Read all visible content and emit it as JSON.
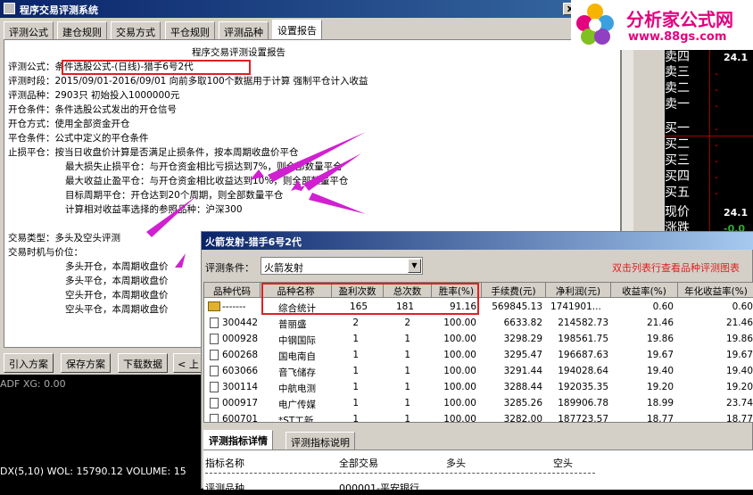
{
  "main_window": {
    "title": "程序交易评测系统",
    "close_label": "x",
    "tabs": [
      "评测公式",
      "建仓规则",
      "交易方式",
      "平仓规则",
      "评测品种",
      "设置报告"
    ],
    "report": {
      "heading": "程序交易评测设置报告",
      "lines": [
        "评测公式：条件选股公式-(日线)-猎手6号2代",
        "评测时段：2015/09/01-2016/09/01  向前多取100个数据用于计算  强制平仓计入收益",
        "评测品种：2903只  初始投入1000000元",
        "开仓条件：条件选股公式发出的开仓信号",
        "开仓方式：使用全部资金开仓",
        "平仓条件：公式中定义的平仓条件",
        "止损平仓：按当日收盘价计算是否满足止损条件，按本周期收盘价平仓",
        "最大损失止损平仓：与开仓资金相比亏损达到7%，则全部数量平仓",
        "最大收益止盈平仓：与开仓资金相比收益达到10%，则全部数量平仓",
        "目标周期平仓：开仓达到20个周期，则全部数量平仓",
        "计算相对收益率选择的参照品种：沪深300",
        "交易类型：多头及空头评测",
        "交易时机与价位：",
        "多头开仓，本周期收盘价",
        "多头平仓，本周期收盘价",
        "空头开仓，本周期收盘价",
        "空头平仓，本周期收盘价"
      ]
    },
    "buttons": [
      "引入方案",
      "保存方案",
      "下载数据",
      "< 上"
    ]
  },
  "logo": {
    "name": "分析家公式网",
    "url": "www.88gs.com"
  },
  "quote_panel": {
    "rows": [
      {
        "label": "卖四",
        "value": "24.1"
      },
      {
        "label": "卖三",
        "value": ""
      },
      {
        "label": "卖二",
        "value": ""
      },
      {
        "label": "卖一",
        "value": ""
      },
      {
        "label": "买一",
        "value": ""
      },
      {
        "label": "买二",
        "value": ""
      },
      {
        "label": "买三",
        "value": ""
      },
      {
        "label": "买四",
        "value": ""
      },
      {
        "label": "买五",
        "value": ""
      },
      {
        "label": "现价",
        "value": "24.1"
      },
      {
        "label": "涨跌",
        "value": "-0.0"
      }
    ],
    "value_color": "#ffffff",
    "dash_color": "#e00000"
  },
  "chart_info": {
    "indicator_line": "ADF XG: 0.00",
    "volume_line": "DX(5,10) WOL: 15790.12  VOLUME: 15"
  },
  "result_dialog": {
    "title": "火箭发射-猎手6号2代",
    "condition_label": "评测条件：",
    "condition_value": "火箭发射",
    "hint": "双击列表行查看品种评测图表",
    "hint_color": "#e02020",
    "columns": [
      "品种代码",
      "品种名称",
      "盈利次数",
      "总次数",
      "胜率(%)",
      "手续费(元)",
      "净利润(元)",
      "收益率(%)",
      "年化收益率(%)"
    ],
    "rows": [
      {
        "code": "-------",
        "name": "综合统计",
        "wins": "165",
        "total": "181",
        "rate": "91.16",
        "fee": "569845.13",
        "profit": "1741901...",
        "ret": "0.60",
        "annual": "0.60"
      },
      {
        "code": "300442",
        "name": "普丽盛",
        "wins": "2",
        "total": "2",
        "rate": "100.00",
        "fee": "6633.82",
        "profit": "214582.73",
        "ret": "21.46",
        "annual": "21.46"
      },
      {
        "code": "000928",
        "name": "中钢国际",
        "wins": "1",
        "total": "1",
        "rate": "100.00",
        "fee": "3298.29",
        "profit": "198561.75",
        "ret": "19.86",
        "annual": "19.86"
      },
      {
        "code": "600268",
        "name": "国电南自",
        "wins": "1",
        "total": "1",
        "rate": "100.00",
        "fee": "3295.47",
        "profit": "196687.63",
        "ret": "19.67",
        "annual": "19.67"
      },
      {
        "code": "603066",
        "name": "音飞储存",
        "wins": "1",
        "total": "1",
        "rate": "100.00",
        "fee": "3291.44",
        "profit": "194028.64",
        "ret": "19.40",
        "annual": "19.40"
      },
      {
        "code": "300114",
        "name": "中航电测",
        "wins": "1",
        "total": "1",
        "rate": "100.00",
        "fee": "3288.44",
        "profit": "192035.35",
        "ret": "19.20",
        "annual": "19.20"
      },
      {
        "code": "000917",
        "name": "电广传媒",
        "wins": "1",
        "total": "1",
        "rate": "100.00",
        "fee": "3285.26",
        "profit": "189906.78",
        "ret": "18.99",
        "annual": "23.74"
      },
      {
        "code": "600701",
        "name": "*ST工新",
        "wins": "1",
        "total": "1",
        "rate": "100.00",
        "fee": "3282.00",
        "profit": "187723.57",
        "ret": "18.77",
        "annual": "18.77"
      }
    ],
    "bottom_tabs": [
      "评测指标详情",
      "评测指标说明"
    ],
    "detail_headers": [
      "指标名称",
      "全部交易",
      "多头",
      "空头"
    ],
    "detail_row": {
      "name": "评测品种",
      "all": "000001-平安银行"
    }
  },
  "annotation_color": "#e02020",
  "arrow_color": "#d020d0"
}
